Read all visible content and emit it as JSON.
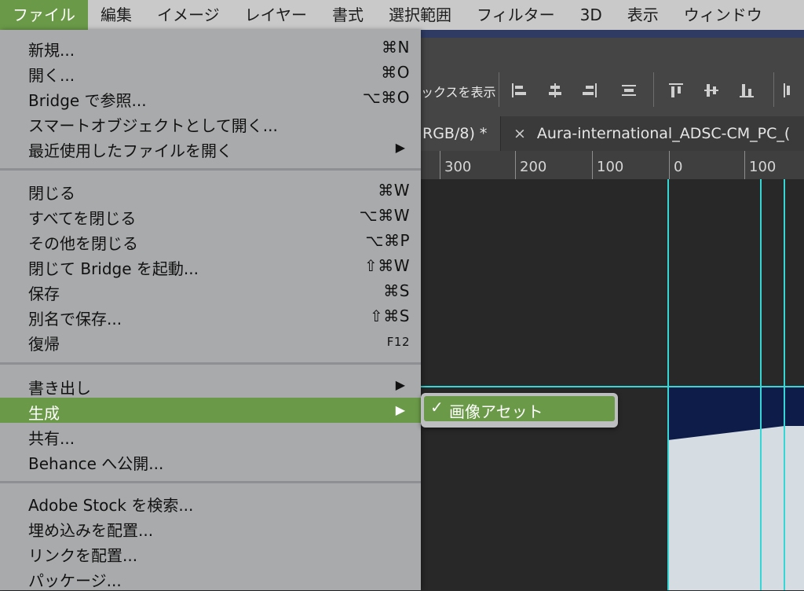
{
  "menubar": {
    "items": [
      "ファイル",
      "編集",
      "イメージ",
      "レイヤー",
      "書式",
      "選択範囲",
      "フィルター",
      "3D",
      "表示",
      "ウィンドウ"
    ]
  },
  "toolbar": {
    "label": "ックスを表示"
  },
  "tabs": {
    "tab1": "RGB/8) *",
    "tab2_close": "×",
    "tab2": "Aura-international_ADSC-CM_PC_("
  },
  "ruler": {
    "labels": [
      "300",
      "200",
      "100",
      "0",
      "100"
    ]
  },
  "file_menu": {
    "items": [
      {
        "label": "新規...",
        "shortcut": "⌘N"
      },
      {
        "label": "開く...",
        "shortcut": "⌘O"
      },
      {
        "label": "Bridge で参照...",
        "shortcut": "⌥⌘O"
      },
      {
        "label": "スマートオブジェクトとして開く...",
        "shortcut": ""
      },
      {
        "label": "最近使用したファイルを開く",
        "shortcut": "▶"
      },
      {
        "label": "閉じる",
        "shortcut": "⌘W"
      },
      {
        "label": "すべてを閉じる",
        "shortcut": "⌥⌘W"
      },
      {
        "label": "その他を閉じる",
        "shortcut": "⌥⌘P"
      },
      {
        "label": "閉じて Bridge を起動...",
        "shortcut": "⇧⌘W"
      },
      {
        "label": "保存",
        "shortcut": "⌘S"
      },
      {
        "label": "別名で保存...",
        "shortcut": "⇧⌘S"
      },
      {
        "label": "復帰",
        "shortcut": "F12"
      },
      {
        "label": "書き出し",
        "shortcut": "▶"
      },
      {
        "label": "生成",
        "shortcut": "▶"
      },
      {
        "label": "共有...",
        "shortcut": ""
      },
      {
        "label": "Behance へ公開...",
        "shortcut": ""
      },
      {
        "label": "Adobe Stock を検索...",
        "shortcut": ""
      },
      {
        "label": "埋め込みを配置...",
        "shortcut": ""
      },
      {
        "label": "リンクを配置...",
        "shortcut": ""
      },
      {
        "label": "パッケージ...",
        "shortcut": ""
      }
    ]
  },
  "submenu": {
    "check": "✓",
    "label": "画像アセット"
  },
  "colors": {
    "accent": "#6a9a48",
    "menu_bg": "#a9aaac",
    "guide": "#37d6d6",
    "doc_navy": "#0e1c4a"
  }
}
